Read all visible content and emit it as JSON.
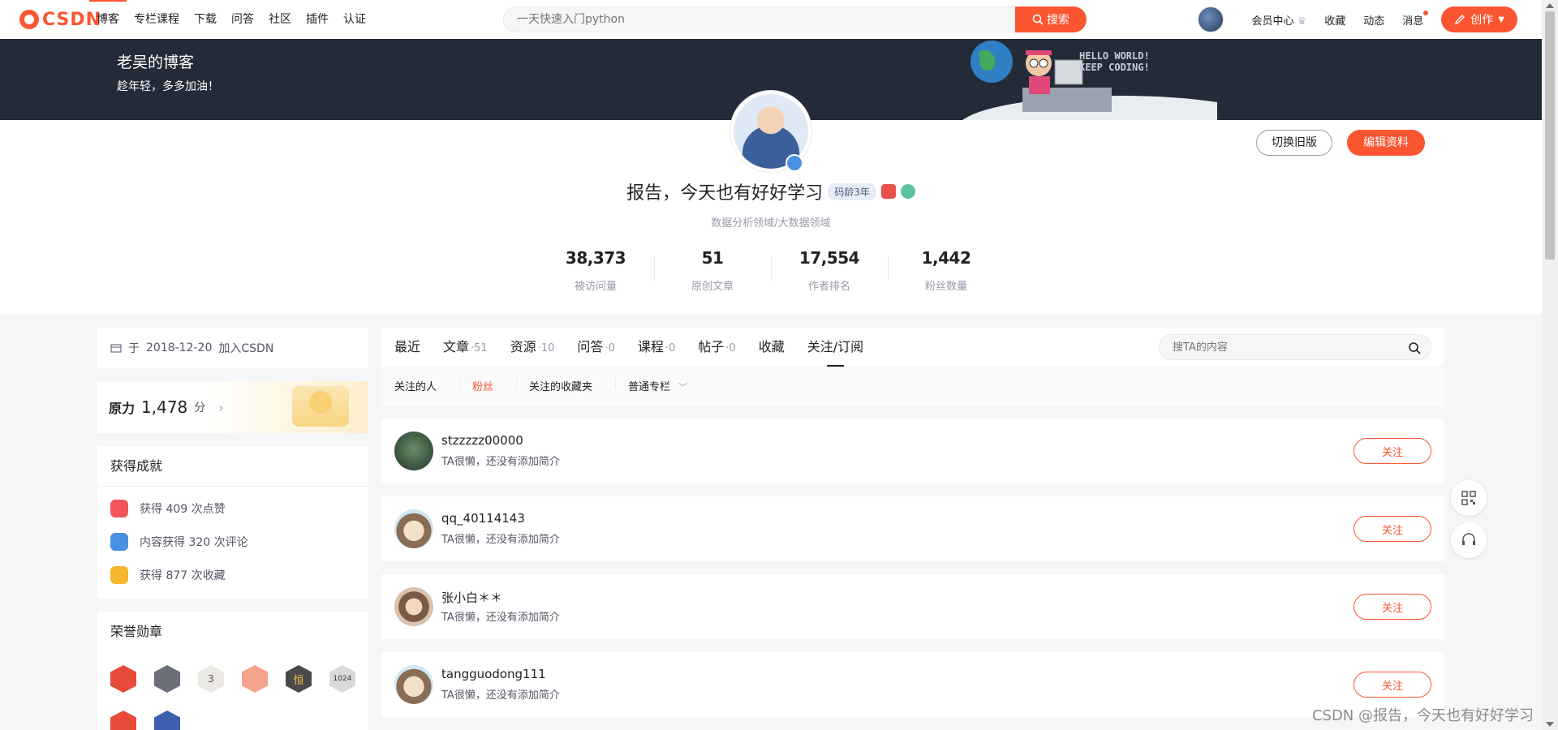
{
  "topnav": {
    "logo": "CSDN",
    "links": [
      "博客",
      "专栏课程",
      "下载",
      "问答",
      "社区",
      "插件",
      "认证"
    ],
    "search_placeholder": "一天快速入门python",
    "search_button": "搜索",
    "right": {
      "vip": "会员中心",
      "favorites": "收藏",
      "activity": "动态",
      "messages": "消息",
      "create": "创作"
    }
  },
  "banner": {
    "title": "老吴的博客",
    "subtitle": "趁年轻，多多加油！",
    "art_text_1": "HELLO WORLD!",
    "art_text_2": "KEEP CODING!"
  },
  "profile": {
    "name": "报告，今天也有好好学习",
    "code_age": "码龄3年",
    "description": "数据分析领域/大数据领域",
    "switch_button": "切换旧版",
    "edit_button": "编辑资料",
    "stats": [
      {
        "value": "38,373",
        "label": "被访问量"
      },
      {
        "value": "51",
        "label": "原创文章"
      },
      {
        "value": "17,554",
        "label": "作者排名"
      },
      {
        "value": "1,442",
        "label": "粉丝数量"
      }
    ]
  },
  "sidebar": {
    "join_prefix": "于",
    "join_date": "2018-12-20",
    "join_suffix": "加入CSDN",
    "score_title": "原力",
    "score_value": "1,478",
    "score_unit": "分",
    "achievements_title": "获得成就",
    "achievements": [
      {
        "text": "获得 409 次点赞",
        "color": "#f2545b"
      },
      {
        "text": "内容获得 320 次评论",
        "color": "#4a90e2"
      },
      {
        "text": "获得 877 次收藏",
        "color": "#f5b52e"
      }
    ],
    "honors_title": "荣誉勋章",
    "medals": [
      {
        "name": "medal-1-icon",
        "color": "#e84b3c"
      },
      {
        "name": "medal-2-icon",
        "color": "#6b6f79"
      },
      {
        "name": "medal-3-icon",
        "color": "#ece9e4"
      },
      {
        "name": "medal-4-icon",
        "color": "#f4a38b"
      },
      {
        "name": "medal-5-icon",
        "color": "#4a4a4a"
      },
      {
        "name": "medal-6-icon",
        "color": "#d9d9d9"
      },
      {
        "name": "medal-7-icon",
        "color": "#e84b3c"
      },
      {
        "name": "medal-8-icon",
        "color": "#3f5fb0"
      }
    ],
    "medal_3_label": "3",
    "medal_5_label": "恒",
    "medal_6_label": "1024"
  },
  "main": {
    "tabs": [
      {
        "label": "最近",
        "count": ""
      },
      {
        "label": "文章",
        "count": "·51"
      },
      {
        "label": "资源",
        "count": "·10"
      },
      {
        "label": "问答",
        "count": "·0"
      },
      {
        "label": "课程",
        "count": "·0"
      },
      {
        "label": "帖子",
        "count": "·0"
      },
      {
        "label": "收藏",
        "count": ""
      },
      {
        "label": "关注/订阅",
        "count": ""
      }
    ],
    "search_placeholder": "搜TA的内容",
    "subtabs": [
      "关注的人",
      "粉丝",
      "关注的收藏夹",
      "普通专栏"
    ],
    "follow_label": "关注",
    "users": [
      {
        "name": "stzzzzz00000",
        "desc": "TA很懒，还没有添加简介",
        "avatar_color": "#2d4a3a"
      },
      {
        "name": "qq_40114143",
        "desc": "TA很懒，还没有添加简介",
        "avatar_color": "#9ec7e0"
      },
      {
        "name": "张小白＊＊",
        "desc": "TA很懒，还没有添加简介",
        "avatar_color": "#c9a98a"
      },
      {
        "name": "tangguodong111",
        "desc": "TA很懒，还没有添加简介",
        "avatar_color": "#9ec7e0"
      }
    ]
  },
  "watermark": "CSDN @报告，今天也有好好学习"
}
